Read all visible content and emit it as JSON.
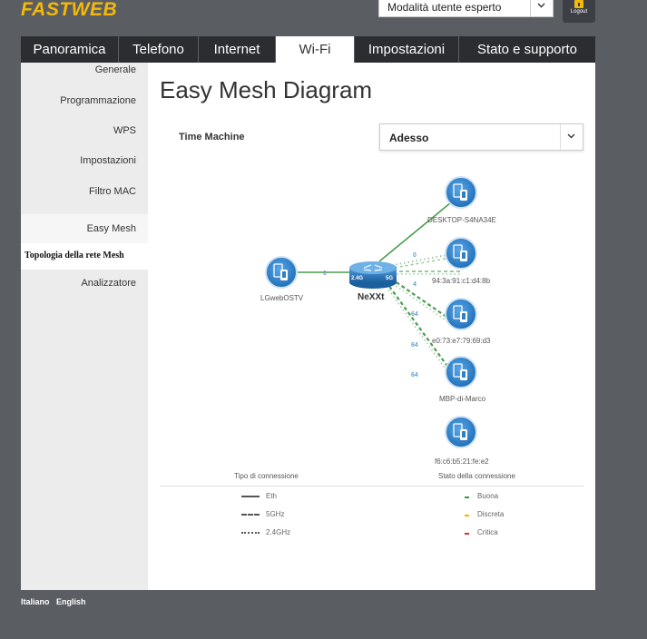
{
  "header": {
    "logo_text": "FASTWEB",
    "mode_select": {
      "value": "Modalità utente esperto",
      "icon": "chevron-down-icon"
    },
    "logout": {
      "label": "Logout",
      "icon": "lock-icon"
    }
  },
  "nav": {
    "tabs": [
      {
        "label": "Panoramica"
      },
      {
        "label": "Telefono"
      },
      {
        "label": "Internet"
      },
      {
        "label": "Wi-Fi",
        "active": true
      },
      {
        "label": "Impostazioni"
      },
      {
        "label": "Stato e supporto"
      }
    ]
  },
  "sidebar": {
    "items": [
      {
        "label": "Generale"
      },
      {
        "label": "Programmazione"
      },
      {
        "label": "WPS"
      },
      {
        "label": "Impostazioni"
      },
      {
        "label": "Filtro MAC"
      },
      {
        "label": "Easy Mesh",
        "active": true
      },
      {
        "label": "Analizzatore"
      }
    ],
    "subitem": {
      "label": "Topologia della rete Mesh"
    }
  },
  "main": {
    "title": "Easy Mesh Diagram",
    "time_machine": {
      "label": "Time Machine",
      "value": "Adesso"
    }
  },
  "diagram": {
    "router": {
      "label": "NeXXt",
      "badge_left": "2.4G",
      "badge_right": "5G"
    },
    "nodes": [
      {
        "label": "LGwebOSTV",
        "band": "0"
      },
      {
        "label": "DESKTOP-S4NA34E",
        "band": "0"
      },
      {
        "label": "94:3a:91:c1:d4:8b",
        "band": "4"
      },
      {
        "label": "e0:73:e7:79:69:d3",
        "band": "64"
      },
      {
        "label": "MBP-di-Marco",
        "band": "64"
      },
      {
        "label": "f6:c6:b5:21:fe:e2",
        "band": "64"
      }
    ]
  },
  "legend": {
    "connection_type": {
      "title": "Tipo di connessione",
      "items": [
        {
          "label": "Eth"
        },
        {
          "label": "5GHz"
        },
        {
          "label": "2.4GHz"
        }
      ]
    },
    "connection_status": {
      "title": "Stato della connessione",
      "items": [
        {
          "label": "Buona",
          "color": "#2e9e3e"
        },
        {
          "label": "Discreta",
          "color": "#e6b800"
        },
        {
          "label": "Critica",
          "color": "#d9342b"
        }
      ]
    }
  },
  "footer": {
    "languages": [
      {
        "label": "Italiano"
      },
      {
        "label": "English"
      }
    ]
  },
  "colors": {
    "brand": "#f5b90a",
    "link_good": "#4a9d4f",
    "device_blue": "#2f7fc7"
  }
}
